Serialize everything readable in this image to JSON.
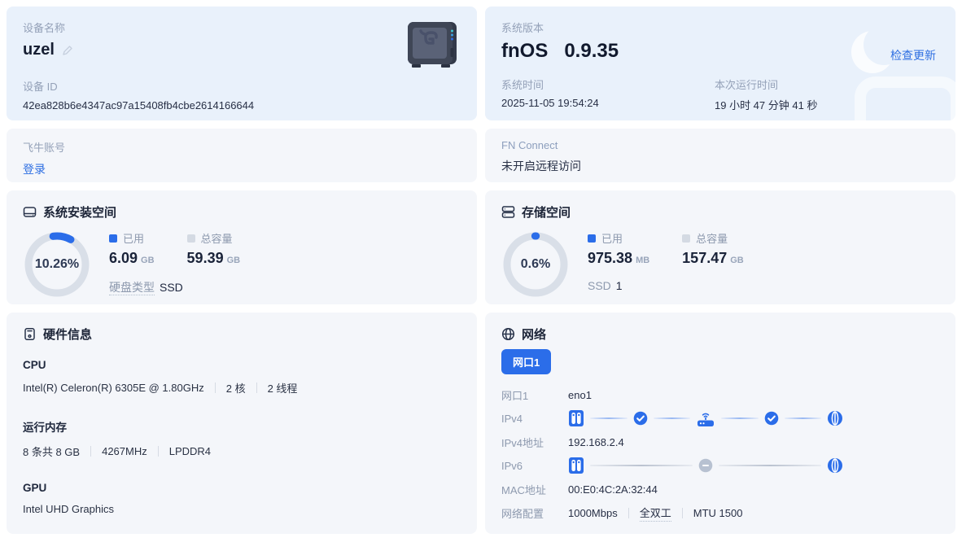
{
  "colors": {
    "accent": "#2B6DE9",
    "link": "#2E6FE2",
    "card_blue": "#E9F1FB",
    "card_gray": "#F4F6FA"
  },
  "icons": {
    "device_art": "nas-device",
    "edit": "pencil-icon",
    "system_space": "hard-drive-icon",
    "storage_space": "stacked-drives-icon",
    "hardware": "pc-case-icon",
    "network": "globe-icon",
    "host": "nas-host-icon",
    "ok": "check-circle-icon",
    "router": "router-icon",
    "internet": "globe-icon",
    "off": "minus-circle-icon"
  },
  "device": {
    "name_label": "设备名称",
    "name": "uzel",
    "id_label": "设备 ID",
    "id": "42ea828b6e4347ac97a15408fb4cbe2614166644"
  },
  "system": {
    "version_label": "系统版本",
    "os_name": "fnOS",
    "version": "0.9.35",
    "check_update": "检查更新",
    "time_label": "系统时间",
    "time": "2025-11-05 19:54:24",
    "uptime_label": "本次运行时间",
    "uptime": "19 小时 47 分钟 41 秒"
  },
  "account": {
    "label": "飞牛账号",
    "login": "登录"
  },
  "fn_connect": {
    "label": "FN Connect",
    "status": "未开启远程访问"
  },
  "system_space": {
    "title": "系统安装空间",
    "percent": "10.26%",
    "percent_value": 10.26,
    "used_label": "已用",
    "used_value": "6.09",
    "used_unit": "GB",
    "total_label": "总容量",
    "total_value": "59.39",
    "total_unit": "GB",
    "disk_type_label": "硬盘类型",
    "disk_type": "SSD"
  },
  "storage_space": {
    "title": "存储空间",
    "percent": "0.6%",
    "percent_value": 0.6,
    "used_label": "已用",
    "used_value": "975.38",
    "used_unit": "MB",
    "total_label": "总容量",
    "total_value": "157.47",
    "total_unit": "GB",
    "ssd_label": "SSD",
    "ssd_value": "1"
  },
  "hardware": {
    "title": "硬件信息",
    "cpu_label": "CPU",
    "cpu_model": "Intel(R) Celeron(R) 6305E @ 1.80GHz",
    "cpu_cores": "2 核",
    "cpu_threads": "2 线程",
    "mem_label": "运行内存",
    "mem_sticks": "8 条共 8 GB",
    "mem_freq": "4267MHz",
    "mem_type": "LPDDR4",
    "gpu_label": "GPU",
    "gpu_model": "Intel UHD Graphics"
  },
  "network": {
    "title": "网络",
    "tab": "网口1",
    "port_label": "网口1",
    "port_value": "eno1",
    "ipv4_label": "IPv4",
    "ipv4_addr_label": "IPv4地址",
    "ipv4_addr": "192.168.2.4",
    "ipv6_label": "IPv6",
    "mac_label": "MAC地址",
    "mac": "00:E0:4C:2A:32:44",
    "config_label": "网络配置",
    "speed": "1000Mbps",
    "duplex": "全双工",
    "mtu": "MTU 1500"
  }
}
